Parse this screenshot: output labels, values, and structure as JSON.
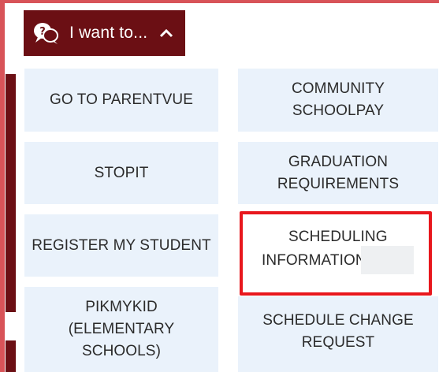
{
  "menu": {
    "toggle_label": "I want to...",
    "icon": "chat-question-icon",
    "expand_icon": "chevron-up-icon",
    "accent_color": "#6b0f14"
  },
  "links": {
    "left": [
      {
        "label": "GO TO PARENTVUE"
      },
      {
        "label": "STOPIT"
      },
      {
        "label": "REGISTER MY STUDENT"
      },
      {
        "label": "PIKMYKID\n(ELEMENTARY\nSCHOOLS)"
      }
    ],
    "right": [
      {
        "label": "COMMUNITY\nSCHOOLPAY"
      },
      {
        "label": "GRADUATION\nREQUIREMENTS"
      },
      {
        "label_line1": "SCHEDULING",
        "label_line2": "INFORMATION"
      },
      {
        "label": "SCHEDULE CHANGE\nREQUEST"
      }
    ]
  },
  "highlight_color": "#e8171d"
}
